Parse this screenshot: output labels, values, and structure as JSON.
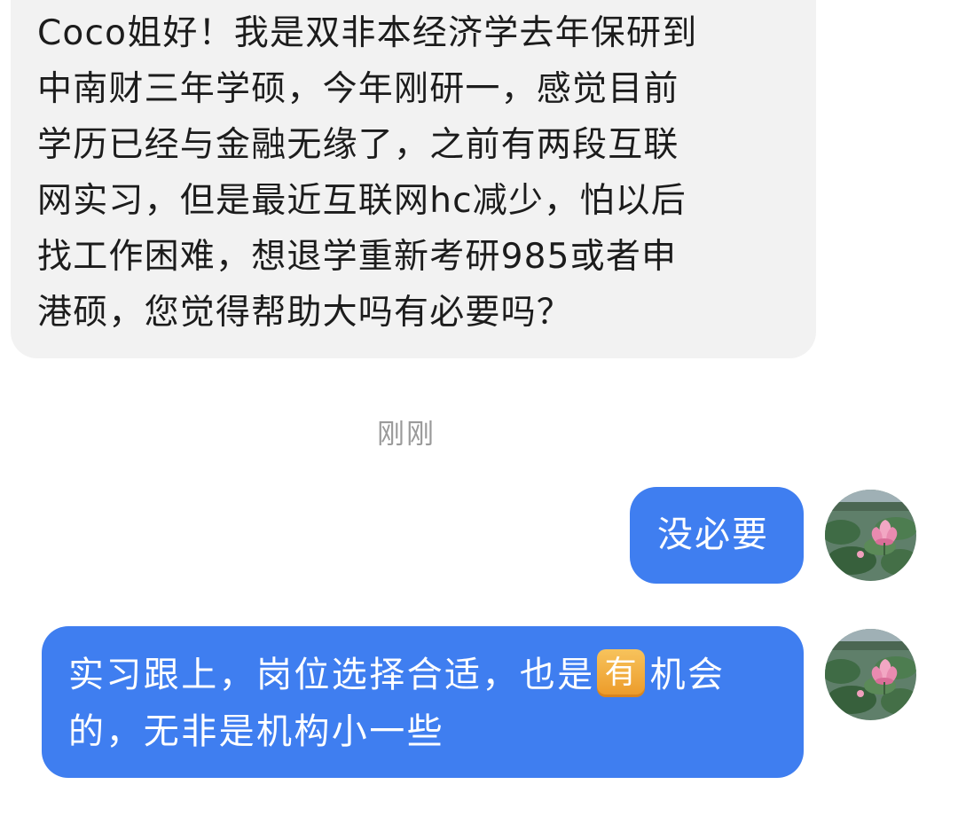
{
  "incoming_message": {
    "lines": [
      "Coco姐好！我是双非本经济学去年保研到",
      "中南财三年学硕，今年刚研一，感觉目前",
      "学历已经与金融无缘了，之前有两段互联",
      "网实习，但是最近互联网hc减少，怕以后",
      "找工作困难，想退学重新考研985或者申",
      "港硕，您觉得帮助大吗有必要吗？"
    ]
  },
  "timestamp": "刚刚",
  "outgoing_messages": [
    {
      "text": "没必要"
    },
    {
      "line1_before": "实习跟上，岗位选择合适，也是",
      "emoji_text": "有",
      "line1_after": "机会",
      "line2": "的，无非是机构小一些"
    }
  ],
  "colors": {
    "incoming_bg": "#f2f2f2",
    "outgoing_bg": "#3f7ef0",
    "timestamp": "#9a9a9a",
    "emoji_badge": "#f0a838"
  },
  "icons": {
    "avatar": "lotus-avatar",
    "emoji": "squared-cjk-you-emoji"
  }
}
